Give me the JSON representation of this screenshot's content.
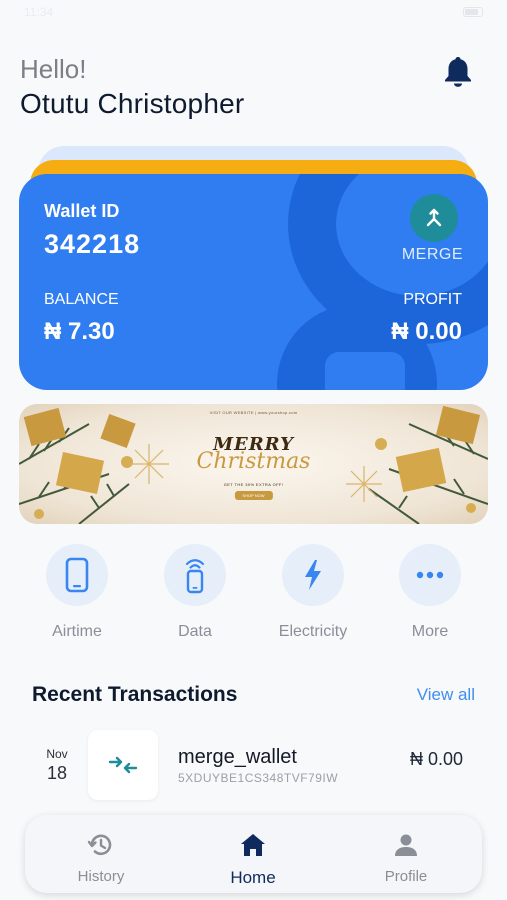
{
  "status_bar": {
    "time": "11:34"
  },
  "header": {
    "greeting": "Hello!",
    "user_name": "Otutu Christopher"
  },
  "wallet": {
    "id_label": "Wallet ID",
    "id_value": "342218",
    "merge_label": "MERGE",
    "balance_label": "BALANCE",
    "balance_value": "₦ 7.30",
    "profit_label": "PROFIT",
    "profit_value": "₦ 0.00"
  },
  "banner": {
    "top_text": "VISIT OUR WEBSITE | www.yourshop.com",
    "merry": "MERRY",
    "christmas": "Christmas",
    "offer": "GET THE 30% EXTRA OFF!",
    "shop_button": "SHOP NOW"
  },
  "quick_actions": [
    {
      "label": "Airtime",
      "icon": "phone-icon"
    },
    {
      "label": "Data",
      "icon": "signal-phone-icon"
    },
    {
      "label": "Electricity",
      "icon": "lightning-icon"
    },
    {
      "label": "More",
      "icon": "more-dots-icon"
    }
  ],
  "recent": {
    "title": "Recent Transactions",
    "view_all": "View all",
    "transactions": [
      {
        "month": "Nov",
        "day": "18",
        "name": "merge_wallet",
        "reference": "5XDUYBE1CS348TVF79IW",
        "amount": "₦ 0.00",
        "icon": "merge-arrows-icon"
      }
    ]
  },
  "bottom_nav": [
    {
      "label": "History",
      "icon": "history-icon",
      "active": false
    },
    {
      "label": "Home",
      "icon": "home-icon",
      "active": true
    },
    {
      "label": "Profile",
      "icon": "person-icon",
      "active": false
    }
  ],
  "colors": {
    "card_blue": "#2f7df0",
    "card_deco": "#1d66d9",
    "accent_yellow": "#f5ad12",
    "merge_teal": "#1f8c9a",
    "link_blue": "#3f8df0",
    "nav_active": "#0f2a5c"
  }
}
